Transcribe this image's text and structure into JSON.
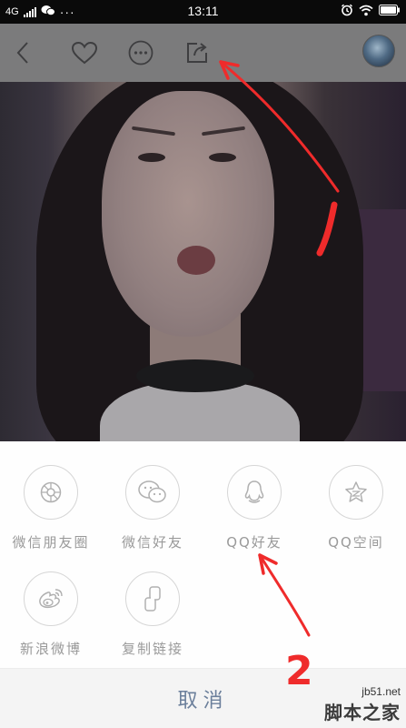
{
  "status_bar": {
    "network": "4G",
    "time": "13:11",
    "more": "···"
  },
  "toolbar": {
    "icons": [
      "back-icon",
      "heart-icon",
      "more-icon",
      "share-icon"
    ]
  },
  "share_sheet": {
    "items": [
      {
        "label": "微信朋友圈",
        "icon": "wechat-moments-icon"
      },
      {
        "label": "微信好友",
        "icon": "wechat-icon"
      },
      {
        "label": "QQ好友",
        "icon": "qq-icon"
      },
      {
        "label": "QQ空间",
        "icon": "qzone-icon"
      },
      {
        "label": "新浪微博",
        "icon": "weibo-icon"
      },
      {
        "label": "复制链接",
        "icon": "copy-link-icon"
      }
    ],
    "cancel_label": "取消"
  },
  "annotations": {
    "number_label": "2"
  },
  "watermark": {
    "url": "jb51.net",
    "brand": "脚本之家"
  },
  "colors": {
    "annotation_red": "#ef2b2b",
    "cancel_text": "#6b7f9b"
  }
}
